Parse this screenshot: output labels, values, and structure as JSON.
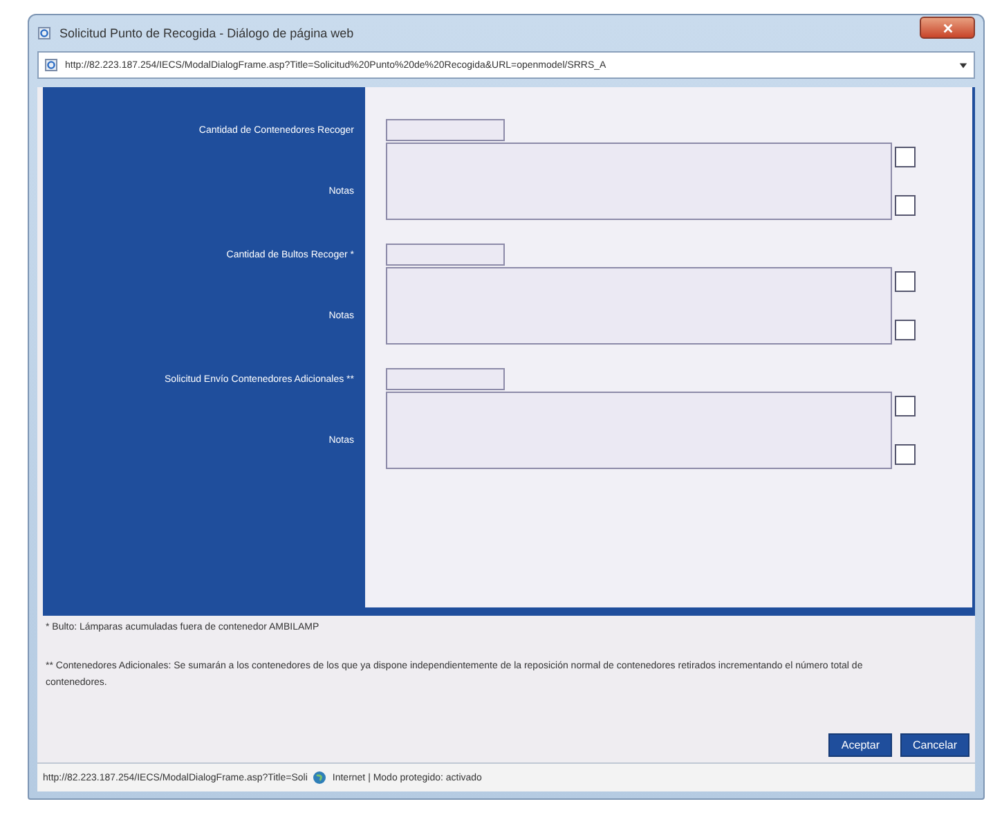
{
  "window": {
    "title": "Solicitud Punto de Recogida - Diálogo de página web"
  },
  "address_bar": {
    "url": "http://82.223.187.254/IECS/ModalDialogFrame.asp?Title=Solicitud%20Punto%20de%20Recogida&URL=openmodel/SRRS_A"
  },
  "form": {
    "fields": [
      {
        "label": "Cantidad de Contenedores Recoger",
        "notes_label": "Notas"
      },
      {
        "label": "Cantidad de Bultos Recoger *",
        "notes_label": "Notas"
      },
      {
        "label": "Solicitud Envío Contenedores Adicionales **",
        "notes_label": "Notas"
      }
    ]
  },
  "footnotes": [
    "* Bulto: Lámparas acumuladas fuera de contenedor AMBILAMP",
    "** Contenedores Adicionales: Se sumarán a los contenedores de los que ya dispone independientemente de la reposición normal de contenedores retirados incrementando el número total de contenedores."
  ],
  "buttons": [
    "Aceptar",
    "Cancelar"
  ],
  "status_bar": {
    "url": "http://82.223.187.254/IECS/ModalDialogFrame.asp?Title=Soli",
    "zone": "Internet | Modo protegido: activado"
  }
}
